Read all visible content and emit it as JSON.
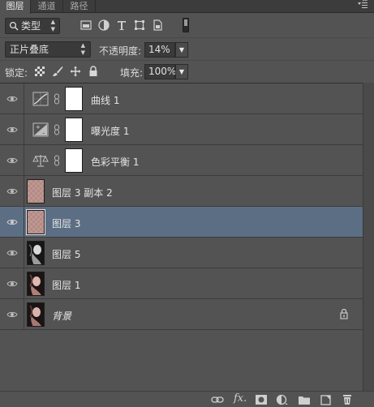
{
  "tabs": [
    {
      "label": "图层",
      "active": true
    },
    {
      "label": "通道",
      "active": false
    },
    {
      "label": "路径",
      "active": false
    }
  ],
  "filter": {
    "kind_label": "类型",
    "icons": [
      "pixel-filter-icon",
      "adjustment-filter-icon",
      "type-filter-icon",
      "shape-filter-icon",
      "smart-object-filter-icon"
    ]
  },
  "blend": {
    "mode": "正片叠底",
    "opacity_label": "不透明度:",
    "opacity_value": "14%"
  },
  "lock": {
    "label": "锁定:",
    "fill_label": "填充:",
    "fill_value": "100%"
  },
  "layers": [
    {
      "name": "曲线 1",
      "kind": "adjustment",
      "icon": "curves-icon",
      "visible": true,
      "selected": false
    },
    {
      "name": "曝光度 1",
      "kind": "adjustment",
      "icon": "exposure-icon",
      "visible": true,
      "selected": false
    },
    {
      "name": "色彩平衡 1",
      "kind": "adjustment",
      "icon": "color-balance-icon",
      "visible": true,
      "selected": false
    },
    {
      "name": "图层 3 副本 2",
      "kind": "pixel",
      "visible": true,
      "selected": false
    },
    {
      "name": "图层 3",
      "kind": "pixel",
      "visible": true,
      "selected": true
    },
    {
      "name": "图层 5",
      "kind": "pixel",
      "visible": true,
      "selected": false
    },
    {
      "name": "图层 1",
      "kind": "pixel",
      "visible": true,
      "selected": false
    },
    {
      "name": "背景",
      "kind": "background",
      "visible": true,
      "selected": false,
      "locked": true
    }
  ],
  "bottom": {
    "fx_label": "fx.",
    "icons": [
      "link-layers-icon",
      "add-layer-style-icon",
      "add-mask-icon",
      "new-adjustment-layer-icon",
      "new-group-icon",
      "new-layer-icon",
      "delete-layer-icon"
    ]
  },
  "colors": {
    "panel": "#535353",
    "selection": "#5c6e84",
    "field": "#3a3a3a"
  }
}
